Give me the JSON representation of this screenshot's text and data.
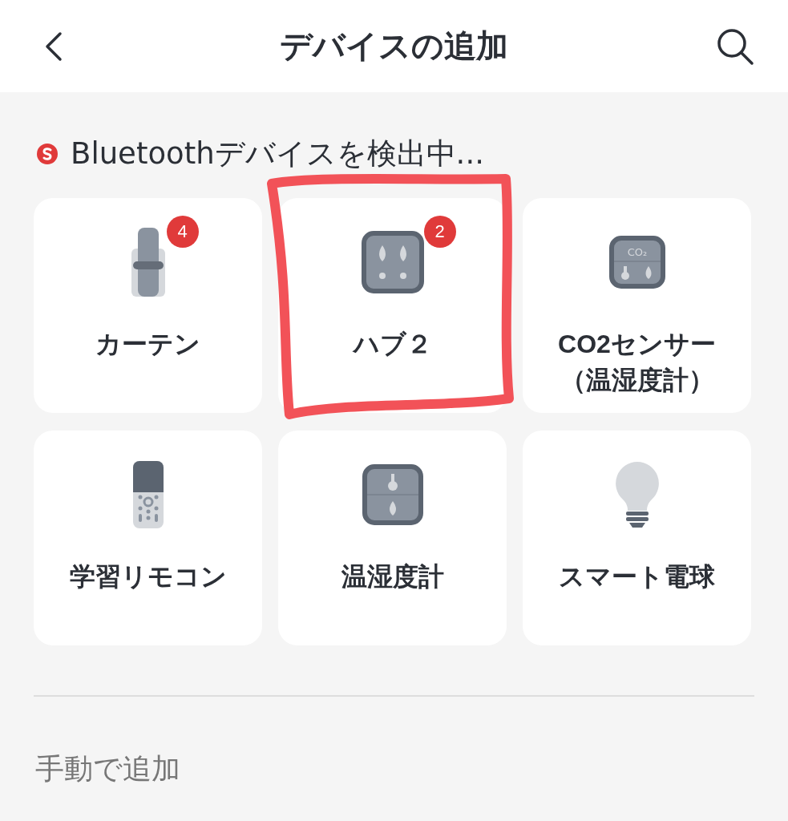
{
  "header": {
    "title": "デバイスの追加"
  },
  "scan_status": {
    "text": "Bluetoothデバイスを検出中..."
  },
  "devices": [
    {
      "kind": "curtain",
      "name": "カーテン",
      "badge": "4",
      "highlighted": false
    },
    {
      "kind": "hub",
      "name": "ハブ２",
      "badge": "2",
      "highlighted": true
    },
    {
      "kind": "co2",
      "name": "CO2センサー（温湿度計）",
      "icon_label": "CO₂",
      "highlighted": false
    },
    {
      "kind": "remote",
      "name": "学習リモコン",
      "highlighted": false
    },
    {
      "kind": "meter",
      "name": "温湿度計",
      "highlighted": false
    },
    {
      "kind": "bulb",
      "name": "スマート電球",
      "highlighted": false
    }
  ],
  "manual_section": {
    "title": "手動で追加"
  }
}
